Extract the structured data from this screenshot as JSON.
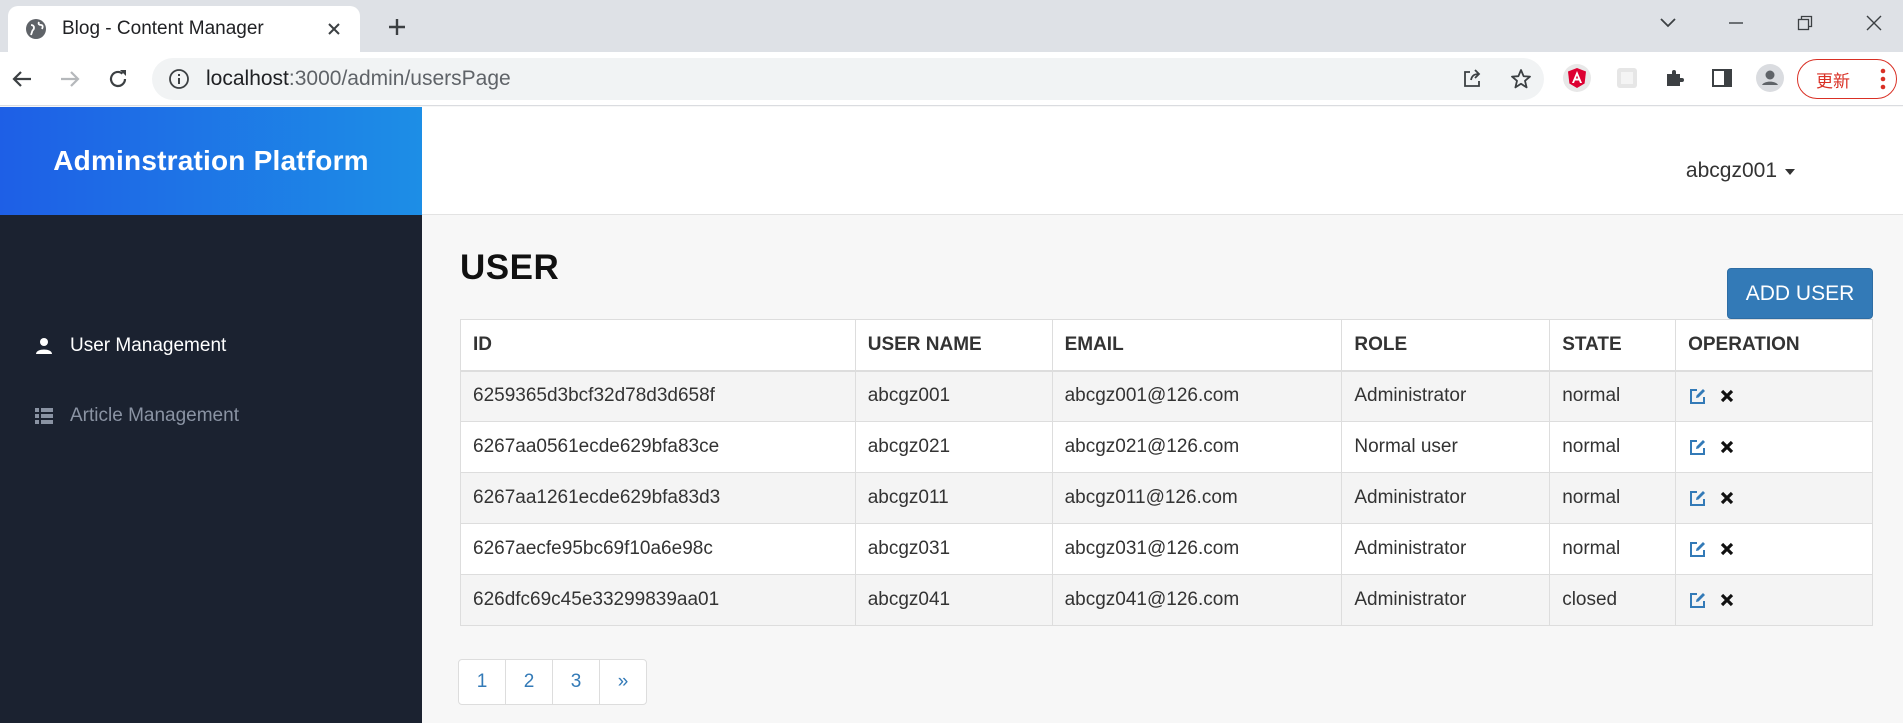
{
  "browser": {
    "tab_title": "Blog - Content Manager",
    "url_host": "localhost",
    "url_rest": ":3000/admin/usersPage",
    "update_label": "更新"
  },
  "app": {
    "brand": "Adminstration Platform",
    "current_user": "abcgz001"
  },
  "sidebar": {
    "items": [
      {
        "label": "User Management",
        "icon": "user-icon",
        "active": true
      },
      {
        "label": "Article Management",
        "icon": "list-icon",
        "active": false
      }
    ]
  },
  "main": {
    "title": "USER",
    "add_button": "ADD USER",
    "columns": [
      "ID",
      "USER NAME",
      "EMAIL",
      "ROLE",
      "STATE",
      "OPERATION"
    ],
    "rows": [
      {
        "id": "6259365d3bcf32d78d3d658f",
        "username": "abcgz001",
        "email": "abcgz001@126.com",
        "role": "Administrator",
        "state": "normal"
      },
      {
        "id": "6267aa0561ecde629bfa83ce",
        "username": "abcgz021",
        "email": "abcgz021@126.com",
        "role": "Normal user",
        "state": "normal"
      },
      {
        "id": "6267aa1261ecde629bfa83d3",
        "username": "abcgz011",
        "email": "abcgz011@126.com",
        "role": "Administrator",
        "state": "normal"
      },
      {
        "id": "6267aecfe95bc69f10a6e98c",
        "username": "abcgz031",
        "email": "abcgz031@126.com",
        "role": "Administrator",
        "state": "normal"
      },
      {
        "id": "626dfc69c45e33299839aa01",
        "username": "abcgz041",
        "email": "abcgz041@126.com",
        "role": "Administrator",
        "state": "closed"
      }
    ],
    "pagination": [
      "1",
      "2",
      "3",
      "»"
    ]
  },
  "colors": {
    "brand_gradient_start": "#1e5fe6",
    "brand_gradient_end": "#1d8ee6",
    "sidebar_bg": "#1b2230",
    "primary": "#337ab7"
  }
}
